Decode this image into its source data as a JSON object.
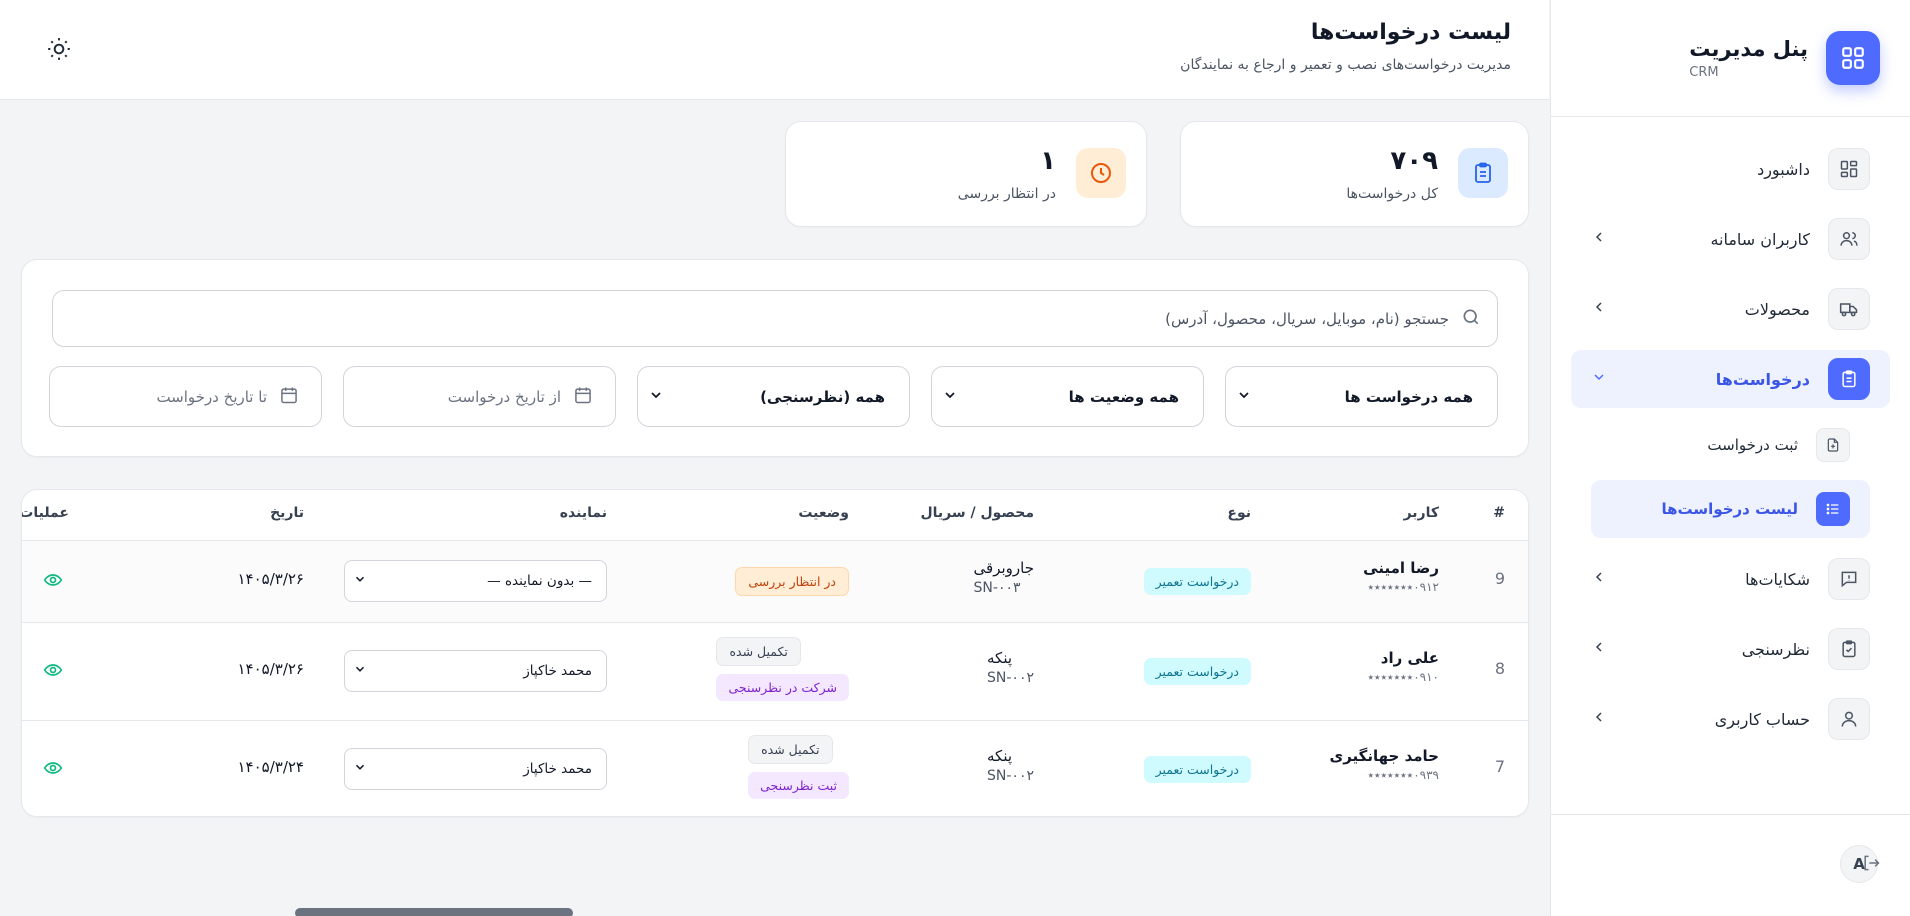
{
  "brand": {
    "title": "پنل مدیریت",
    "subtitle": "CRM"
  },
  "sidebar": {
    "items": [
      {
        "label": "داشبورد"
      },
      {
        "label": "کاربران سامانه"
      },
      {
        "label": "محصولات"
      },
      {
        "label": "درخواست‌ها"
      },
      {
        "label": "شکایات‌ها"
      },
      {
        "label": "نظرسنجی"
      },
      {
        "label": "حساب کاربری"
      }
    ],
    "subitems": [
      {
        "label": "ثبت درخواست"
      },
      {
        "label": "لیست درخواست‌ها"
      }
    ],
    "avatar_letter": "A"
  },
  "header": {
    "title": "لیست درخواست‌ها",
    "subtitle": "مدیریت درخواست‌های نصب و تعمیر و ارجاع به نمایندگان"
  },
  "stats": [
    {
      "value": "۷۰۹",
      "label": "کل درخواست‌ها"
    },
    {
      "value": "۱",
      "label": "در انتظار بررسی"
    }
  ],
  "filters": {
    "search_placeholder": "جستجو (نام، موبایل، سریال، محصول، آدرس)",
    "type_select": "همه درخواست ها",
    "status_select": "همه وضعیت ها",
    "survey_select": "همه (نظرسنجی)",
    "from_date_placeholder": "از تاریخ درخواست",
    "to_date_placeholder": "تا تاریخ درخواست"
  },
  "table": {
    "headers": {
      "num": "#",
      "user": "کاربر",
      "type": "نوع",
      "product": "محصول / سریال",
      "status": "وضعیت",
      "rep": "نماینده",
      "date": "تاریخ",
      "ops": "عملیات"
    },
    "rows": [
      {
        "num": "9",
        "name": "رضا امینی",
        "phone": "۰۹۱۲٭٭٭٭٭٭٭",
        "type": "درخواست تعمیر",
        "product": "جاروبرقی",
        "serial": "SN-۰۰۳",
        "status1": "در انتظار بررسی",
        "status2": "",
        "rep": "— بدون نماینده —",
        "date": "۱۴۰۵/۳/۲۶"
      },
      {
        "num": "8",
        "name": "علی راد",
        "phone": "۰۹۱۰٭٭٭٭٭٭٭",
        "type": "درخواست تعمیر",
        "product": "پنکه",
        "serial": "SN-۰۰۲",
        "status1": "تکمیل شده",
        "status2": "شرکت در نظرسنجی",
        "rep": "محمد خاکپاز",
        "date": "۱۴۰۵/۳/۲۶"
      },
      {
        "num": "7",
        "name": "حامد جهانگیری",
        "phone": "۰۹۳۹٭٭٭٭٭٭٭",
        "type": "درخواست تعمیر",
        "product": "پنکه",
        "serial": "SN-۰۰۲",
        "status1": "تکمیل شده",
        "status2": "ثبت نظرسنجی",
        "rep": "محمد خاکپاز",
        "date": "۱۴۰۵/۳/۲۴"
      }
    ]
  }
}
